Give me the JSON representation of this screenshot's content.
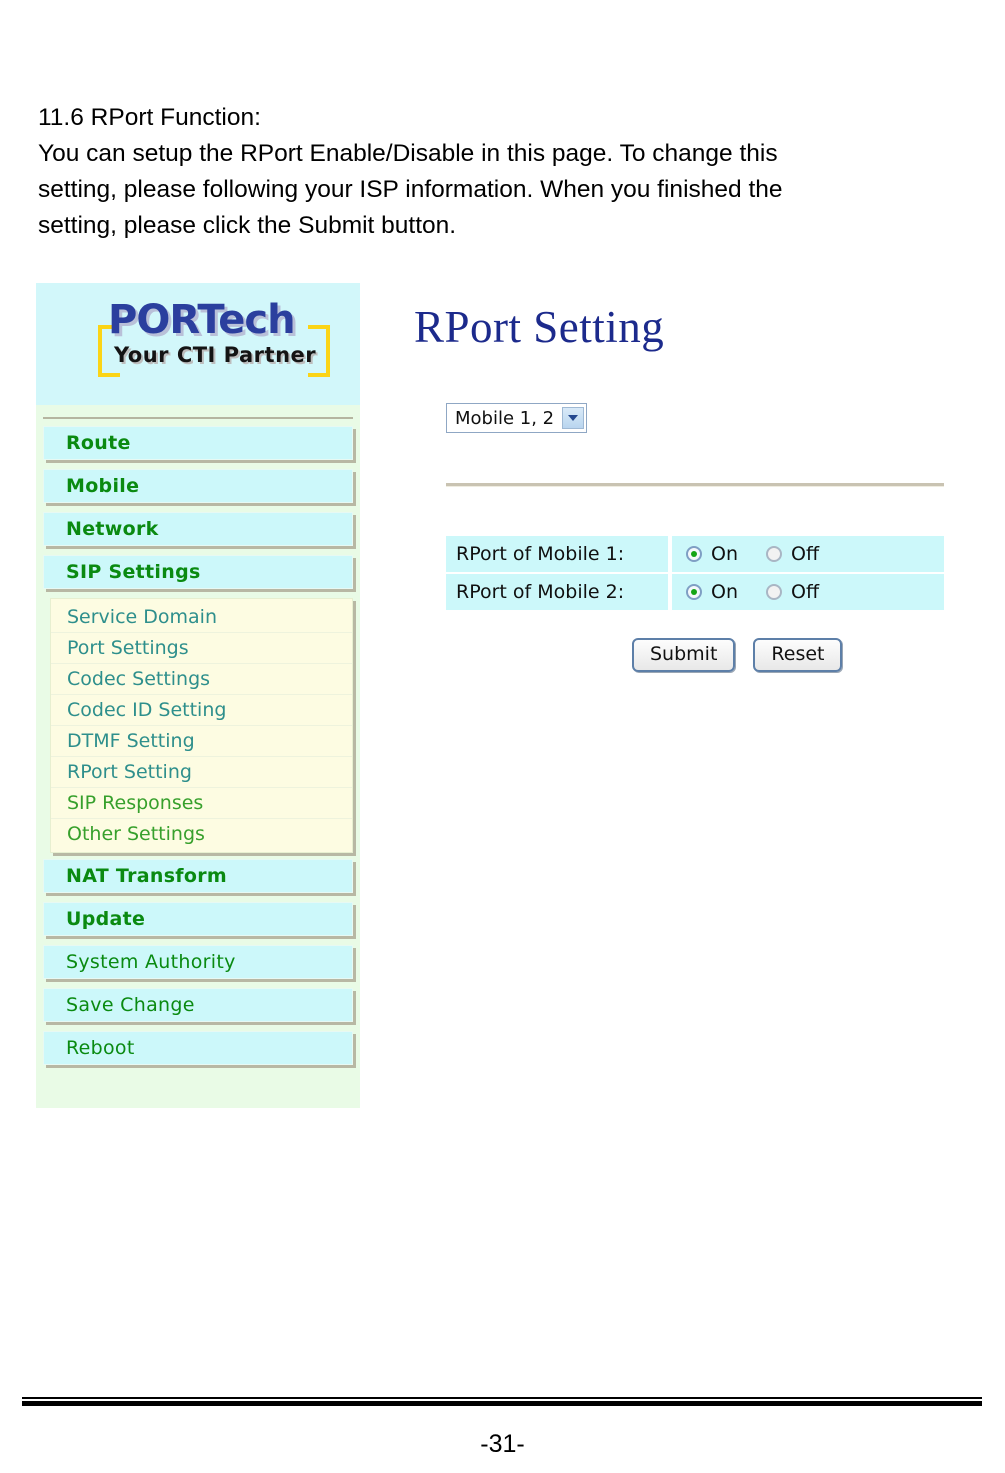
{
  "document": {
    "section_heading": "11.6 RPort Function:",
    "body_lines": [
      "You can setup the RPort Enable/Disable in this page. To change this",
      "setting, please following your ISP information. When you finished the",
      "setting, please click the Submit button."
    ],
    "page_number": "-31-"
  },
  "webui": {
    "logo": {
      "brand": "PORTech",
      "tagline": "Your CTI Partner",
      "brand_color": "#2b3f9e",
      "bracket_color": "#fbd416",
      "background": "#d2f7fa"
    },
    "sidebar": {
      "background": "#e9fbe6",
      "item_background": "#ccf8fa",
      "item_text_color": "#0a8a11",
      "submenu_background": "#fdfce2",
      "submenu_text_color": "#2e8f8c",
      "items": [
        {
          "label": "Route",
          "bold": true
        },
        {
          "label": "Mobile",
          "bold": true
        },
        {
          "label": "Network",
          "bold": true
        },
        {
          "label": "SIP Settings",
          "bold": true
        }
      ],
      "submenu": [
        {
          "label": "Service Domain",
          "color": "teal"
        },
        {
          "label": "Port Settings",
          "color": "teal"
        },
        {
          "label": "Codec Settings",
          "color": "teal"
        },
        {
          "label": "Codec ID Setting",
          "color": "teal"
        },
        {
          "label": "DTMF Setting",
          "color": "teal"
        },
        {
          "label": "RPort Setting",
          "color": "teal"
        },
        {
          "label": "SIP Responses",
          "color": "green"
        },
        {
          "label": "Other Settings",
          "color": "green"
        }
      ],
      "items_after": [
        {
          "label": "NAT Transform",
          "bold": true
        },
        {
          "label": "Update",
          "bold": true
        },
        {
          "label": "System Authority",
          "bold": false
        },
        {
          "label": "Save Change",
          "bold": false
        },
        {
          "label": "Reboot",
          "bold": false
        }
      ]
    },
    "content": {
      "title": "RPort Setting",
      "title_color": "#1c2a8c",
      "mobile_select": {
        "value": "Mobile 1, 2",
        "options": [
          "Mobile 1, 2"
        ]
      },
      "table": {
        "row_background": "#ccf8fa",
        "rows": [
          {
            "label": "RPort of Mobile 1:",
            "options": [
              {
                "label": "On",
                "selected": true
              },
              {
                "label": "Off",
                "selected": false
              }
            ]
          },
          {
            "label": "RPort of Mobile 2:",
            "options": [
              {
                "label": "On",
                "selected": true
              },
              {
                "label": "Off",
                "selected": false
              }
            ]
          }
        ]
      },
      "buttons": {
        "submit": "Submit",
        "reset": "Reset"
      }
    }
  }
}
